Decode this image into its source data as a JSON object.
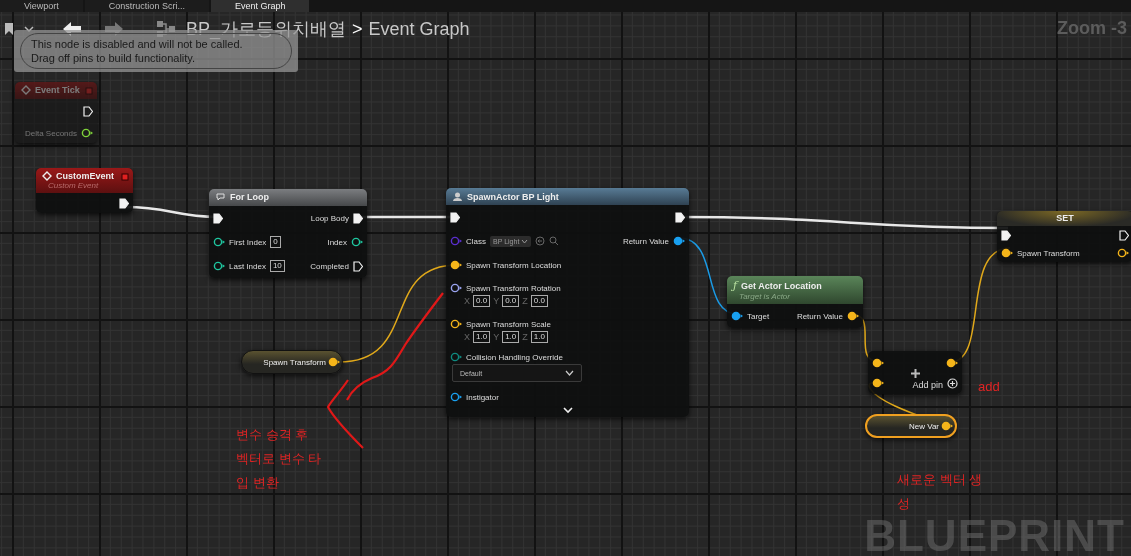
{
  "tabs": [
    {
      "label": "Viewport",
      "selected": false
    },
    {
      "label": "Construction Scri...",
      "selected": false
    },
    {
      "label": "Event Graph",
      "selected": true
    }
  ],
  "breadcrumb": {
    "blueprint": "BP_가로등위치배열",
    "separator": ">",
    "graph": "Event Graph"
  },
  "zoom": "Zoom -3",
  "tooltip": [
    "This node is disabled and will not be called.",
    "Drag off pins to build functionality."
  ],
  "nodes": [
    {
      "kind": "event",
      "title": "Event Tick",
      "disabled": true,
      "rows": [
        {
          "right": {
            "kind": "exec",
            "connected": false
          }
        },
        {
          "right": {
            "kind": "data",
            "label": "Delta Seconds",
            "color": "#7fd33a",
            "connected": false
          }
        }
      ]
    },
    {
      "kind": "event",
      "title": "CustomEvent",
      "subtitle": "Custom Event",
      "disabled": false,
      "rows": [
        {
          "right": {
            "kind": "exec",
            "connected": true
          }
        }
      ]
    },
    {
      "kind": "macro",
      "title": "For Loop",
      "disabled": false,
      "rows": [
        {
          "left": {
            "kind": "exec",
            "connected": true
          },
          "right": {
            "kind": "exec",
            "label": "Loop Body",
            "connected": true
          }
        },
        {
          "left": {
            "kind": "data",
            "label": "First Index",
            "color": "#1fc7a0",
            "connected": false,
            "value": "0"
          },
          "right": {
            "kind": "data",
            "label": "Index",
            "color": "#1fc7a0",
            "connected": false
          }
        },
        {
          "left": {
            "kind": "data",
            "label": "Last Index",
            "color": "#1fc7a0",
            "connected": false,
            "value": "10"
          },
          "right": {
            "kind": "exec",
            "label": "Completed",
            "connected": false
          }
        }
      ]
    },
    {
      "kind": "function",
      "title": "SpawnActor BP Light",
      "disabled": false,
      "rows": [
        {
          "left": {
            "kind": "exec",
            "connected": true
          },
          "right": {
            "kind": "exec",
            "connected": true
          }
        },
        {
          "left": {
            "kind": "data",
            "label": "Class",
            "color": "#5b2ed0",
            "connected": false,
            "select": "BP Light"
          },
          "right": {
            "kind": "data",
            "label": "Return Value",
            "color": "#19a0f0",
            "connected": true
          }
        },
        {
          "left": {
            "kind": "data",
            "label": "Spawn Transform Location",
            "color": "#f5b51a",
            "connected": true
          }
        },
        {
          "left": {
            "kind": "data",
            "label": "Spawn Transform Rotation",
            "color": "#9aa4f0",
            "connected": false,
            "vector": [
              {
                "axis": "X",
                "value": "0.0"
              },
              {
                "axis": "Y",
                "value": "0.0"
              },
              {
                "axis": "Z",
                "value": "0.0"
              }
            ]
          }
        },
        {
          "left": {
            "kind": "data",
            "label": "Spawn Transform Scale",
            "color": "#f5b51a",
            "connected": false,
            "vector": [
              {
                "axis": "X",
                "value": "1.0"
              },
              {
                "axis": "Y",
                "value": "1.0"
              },
              {
                "axis": "Z",
                "value": "1.0"
              }
            ]
          }
        },
        {
          "left": {
            "kind": "data",
            "label": "Collision Handling Override",
            "color": "#0f8a80",
            "connected": false,
            "dropdown": "Default"
          }
        },
        {
          "left": {
            "kind": "data",
            "label": "Instigator",
            "color": "#19a0f0",
            "connected": false
          }
        }
      ]
    },
    {
      "kind": "pure",
      "icon": "ƒ",
      "title": "Get Actor Location",
      "subtitle": "Target is Actor",
      "disabled": false,
      "rows": [
        {
          "left": {
            "kind": "data",
            "label": "Target",
            "color": "#19a0f0",
            "connected": true
          },
          "right": {
            "kind": "data",
            "label": "Return Value",
            "color": "#f5b51a",
            "connected": true
          }
        }
      ]
    },
    {
      "kind": "set",
      "title": "SET",
      "disabled": false,
      "rows": [
        {
          "left": {
            "kind": "exec",
            "connected": true
          },
          "right": {
            "kind": "exec",
            "connected": false
          }
        },
        {
          "left": {
            "kind": "data",
            "label": "Spawn Transform",
            "color": "#f5b51a",
            "connected": true
          },
          "right": {
            "kind": "data",
            "color": "#f5b51a",
            "connected": false
          }
        }
      ]
    },
    {
      "kind": "operator",
      "disabled": false,
      "rows": [
        {
          "left": {
            "kind": "data",
            "color": "#f5b51a",
            "connected": true
          },
          "right": {
            "kind": "data",
            "color": "#f5b51a",
            "connected": true
          }
        },
        {
          "left": {
            "kind": "data",
            "color": "#f5b51a",
            "connected": true
          },
          "right": {
            "kind": "add",
            "label": "Add pin"
          }
        }
      ]
    },
    {
      "kind": "var",
      "title": "Spawn Transform",
      "disabled": false,
      "selected": false,
      "rows": [
        {
          "right": {
            "kind": "data",
            "color": "#f5b51a",
            "connected": true
          }
        }
      ]
    },
    {
      "kind": "var",
      "title": "New Var",
      "disabled": false,
      "selected": true,
      "rows": [
        {
          "right": {
            "kind": "data",
            "color": "#f5b51a",
            "connected": true
          }
        }
      ]
    }
  ],
  "notes": [
    {
      "lines": [
        "변수 승격 후",
        "벡터로 변수 타",
        "입 변환"
      ]
    },
    {
      "lines": [
        "add"
      ]
    },
    {
      "lines": [
        "새로운 벡터 생",
        "성"
      ]
    }
  ],
  "watermark": "BLUEPRINT"
}
